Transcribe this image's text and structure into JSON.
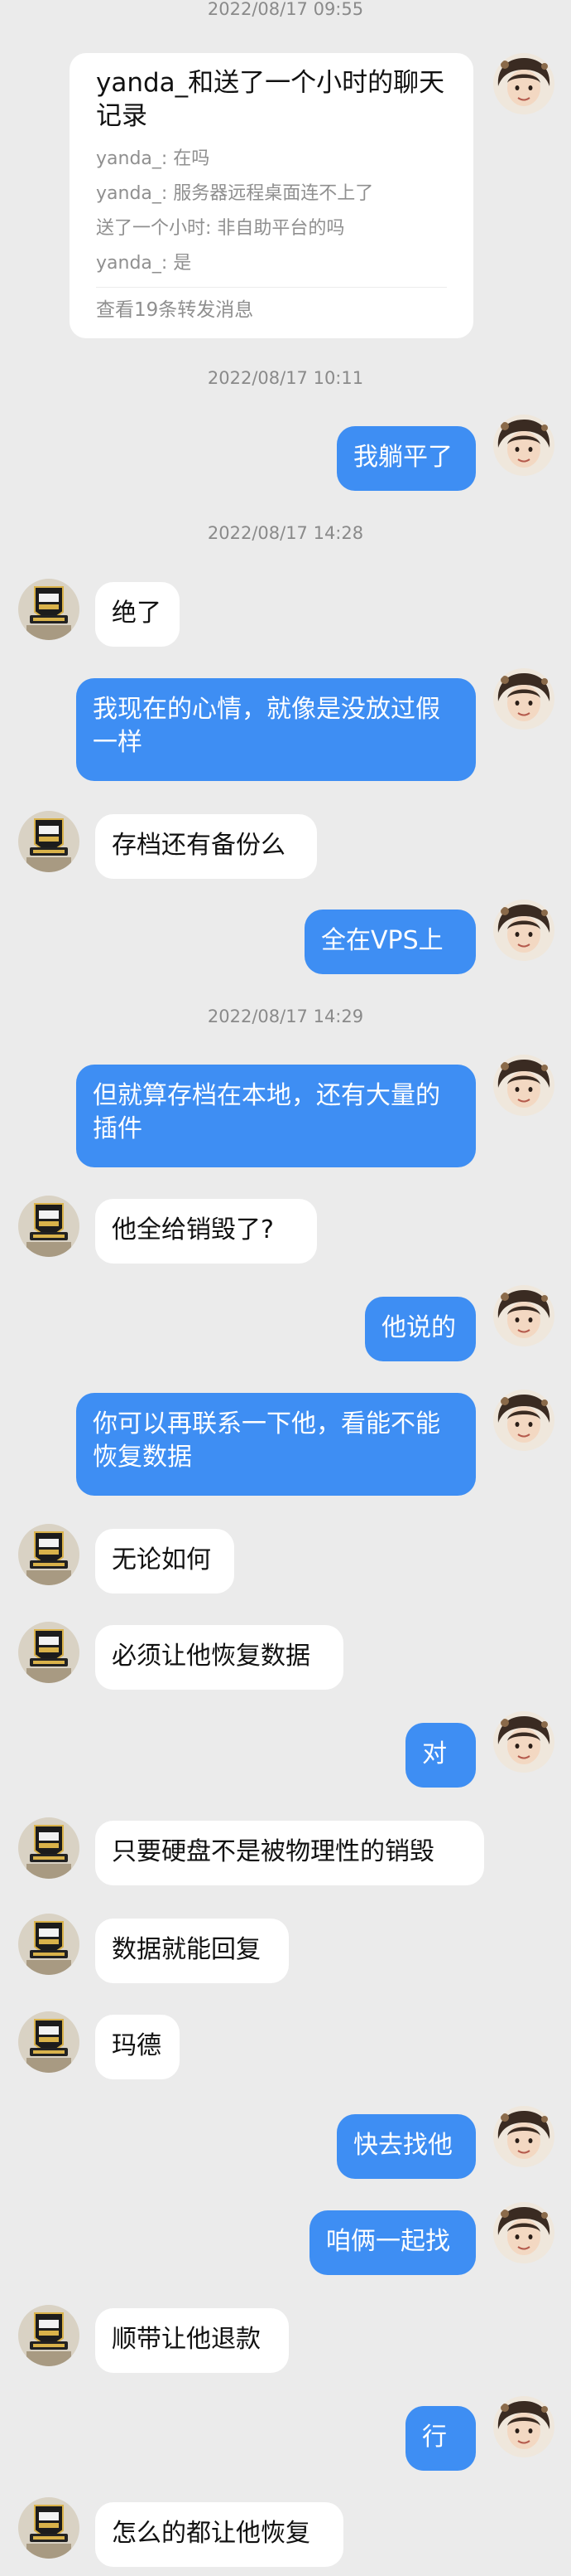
{
  "timestamps": [
    "2022/08/17 09:55",
    "2022/08/17 10:11",
    "2022/08/17 14:28",
    "2022/08/17 14:29"
  ],
  "forward_card": {
    "title": "yanda_和送了一个小时的聊天记录",
    "lines": [
      "yanda_: 在吗",
      "yanda_: 服务器远程桌面连不上了",
      "送了一个小时: 非自助平台的吗",
      "yanda_: 是"
    ],
    "footer": "查看19条转发消息"
  },
  "messages": [
    {
      "side": "out",
      "text": "我躺平了"
    },
    {
      "side": "in",
      "text": "绝了"
    },
    {
      "side": "out",
      "text": "我现在的心情，就像是没放过假一样"
    },
    {
      "side": "in",
      "text": "存档还有备份么"
    },
    {
      "side": "out",
      "text": "全在VPS上"
    },
    {
      "side": "out",
      "text": "但就算存档在本地，还有大量的插件"
    },
    {
      "side": "in",
      "text": "他全给销毁了?"
    },
    {
      "side": "out",
      "text": "他说的"
    },
    {
      "side": "out",
      "text": "你可以再联系一下他，看能不能恢复数据"
    },
    {
      "side": "in",
      "text": "无论如何"
    },
    {
      "side": "in",
      "text": "必须让他恢复数据"
    },
    {
      "side": "out",
      "text": "对"
    },
    {
      "side": "in",
      "text": "只要硬盘不是被物理性的销毁"
    },
    {
      "side": "in",
      "text": "数据就能回复"
    },
    {
      "side": "in",
      "text": "玛德"
    },
    {
      "side": "out",
      "text": "快去找他"
    },
    {
      "side": "out",
      "text": "咱俩一起找"
    },
    {
      "side": "in",
      "text": "顺带让他退款"
    },
    {
      "side": "out",
      "text": "行"
    },
    {
      "side": "in",
      "text": "怎么的都让他恢复"
    }
  ],
  "colors": {
    "background": "#ebebeb",
    "outgoing_bubble": "#3e8ef3",
    "incoming_bubble": "#ffffff",
    "timestamp_text": "#8a8a8a"
  },
  "icons": {
    "self_avatar": "user-photo-avatar",
    "contact_avatar": "badge-logo-avatar"
  }
}
